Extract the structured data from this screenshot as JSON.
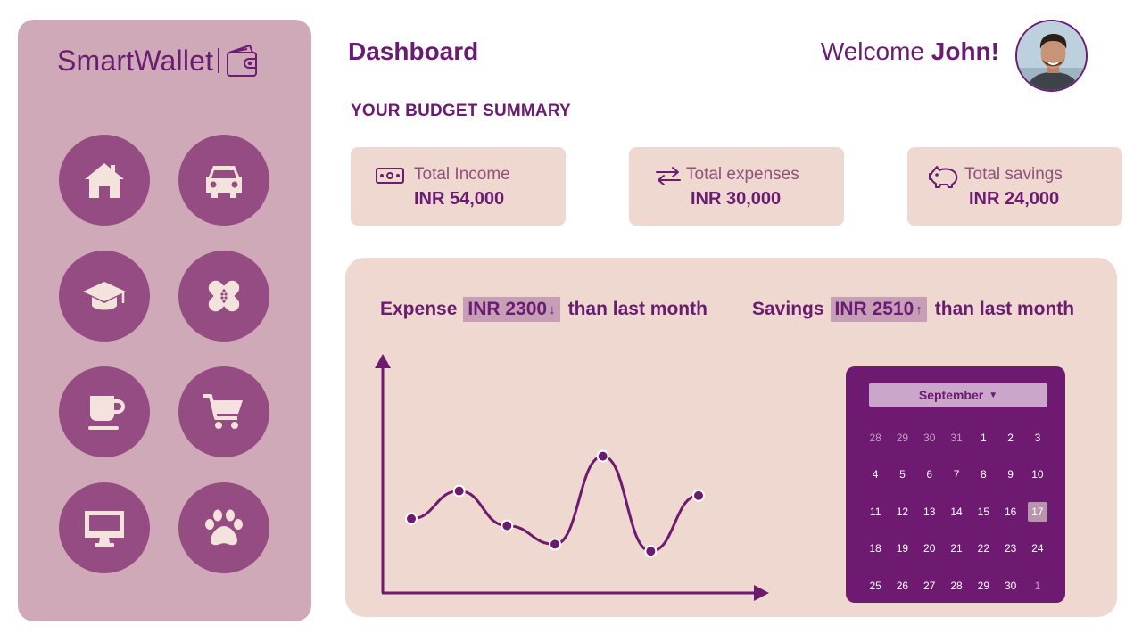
{
  "app": {
    "name": "SmartWallet"
  },
  "header": {
    "title": "Dashboard",
    "welcome_prefix": "Welcome",
    "user_name": "John!"
  },
  "sidebar": {
    "brand_icon": "wallet-icon",
    "categories": [
      {
        "name": "home",
        "icon": "home-icon"
      },
      {
        "name": "car",
        "icon": "car-icon"
      },
      {
        "name": "education",
        "icon": "graduation-cap-icon"
      },
      {
        "name": "health",
        "icon": "bandage-icon"
      },
      {
        "name": "food-drinks",
        "icon": "coffee-cup-icon"
      },
      {
        "name": "shopping",
        "icon": "shopping-cart-icon"
      },
      {
        "name": "electronics",
        "icon": "monitor-icon"
      },
      {
        "name": "pets",
        "icon": "paw-icon"
      }
    ]
  },
  "summary": {
    "heading": "YOUR BUDGET SUMMARY",
    "income": {
      "label": "Total Income",
      "value": "INR 54,000",
      "icon": "cash-icon"
    },
    "expenses": {
      "label": "Total expenses",
      "value": "INR 30,000",
      "icon": "transfer-arrows-icon"
    },
    "savings": {
      "label": "Total savings",
      "value": "INR 24,000",
      "icon": "piggy-bank-icon"
    }
  },
  "comparison": {
    "expense": {
      "label": "Expense",
      "amount": "INR 2300",
      "direction": "down",
      "arrow": "↓",
      "suffix": "than last month"
    },
    "savings": {
      "label": "Savings",
      "amount": "INR 2510",
      "direction": "up",
      "arrow": "↑",
      "suffix": "than last month"
    }
  },
  "chart_data": {
    "type": "line",
    "title": "",
    "xlabel": "",
    "ylabel": "",
    "x": [
      1,
      2,
      3,
      4,
      5,
      6,
      7
    ],
    "values": [
      0.32,
      0.44,
      0.29,
      0.21,
      0.59,
      0.18,
      0.42
    ],
    "ylim": [
      0,
      1
    ],
    "grid": false,
    "smooth": true,
    "color": "#6e1a70"
  },
  "calendar": {
    "month": "September",
    "selected_day": "17",
    "days": [
      {
        "d": "28",
        "muted": true
      },
      {
        "d": "29",
        "muted": true
      },
      {
        "d": "30",
        "muted": true
      },
      {
        "d": "31",
        "muted": true
      },
      {
        "d": "1"
      },
      {
        "d": "2"
      },
      {
        "d": "3"
      },
      {
        "d": "4"
      },
      {
        "d": "5"
      },
      {
        "d": "6"
      },
      {
        "d": "7"
      },
      {
        "d": "8"
      },
      {
        "d": "9"
      },
      {
        "d": "10"
      },
      {
        "d": "11"
      },
      {
        "d": "12"
      },
      {
        "d": "13"
      },
      {
        "d": "14"
      },
      {
        "d": "15"
      },
      {
        "d": "16"
      },
      {
        "d": "17",
        "selected": true
      },
      {
        "d": "18"
      },
      {
        "d": "19"
      },
      {
        "d": "20"
      },
      {
        "d": "21"
      },
      {
        "d": "22"
      },
      {
        "d": "23"
      },
      {
        "d": "24"
      },
      {
        "d": "25"
      },
      {
        "d": "26"
      },
      {
        "d": "27"
      },
      {
        "d": "28"
      },
      {
        "d": "29"
      },
      {
        "d": "30"
      },
      {
        "d": "1",
        "muted": true
      }
    ]
  },
  "colors": {
    "primary": "#6a1b72",
    "sidebar_bg": "#cfa9b7",
    "category_button": "#944c82",
    "card_bg": "#efd8cf",
    "pill_bg": "#c69fb6",
    "calendar_bg": "#6e1a70"
  }
}
